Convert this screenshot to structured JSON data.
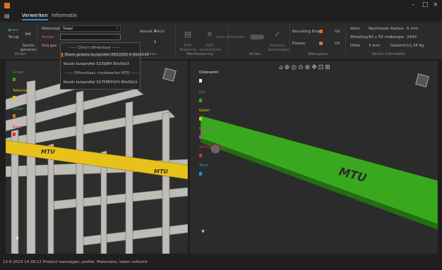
{
  "tabs": {
    "verwerken": "Verwerken",
    "informatie": "Informatie"
  },
  "ribbon": {
    "terug": "Terug",
    "sectie": "Sectie\ngeneren",
    "acties_group": "Acties",
    "materiaal_label": "Materiaal",
    "materiaal_value": "Staal",
    "artikel_label": "Artikel",
    "snij_label": "Snij gas",
    "aantal_label": "Aantal set(s)",
    "aantal_value": "1",
    "aantal2_value": "1",
    "cores_group": "Cores",
    "pdf_tekening": "PDF\nTekening",
    "pdf_verwijderen": "PDF\nverwijderen",
    "werktekening_group": "Werktekening",
    "auto_uitvoeren": "Auto uitvoeren",
    "product_bevestigen": "Product\nbevestigen",
    "acties2_group": "Acties",
    "bounding_box": "Bounding Box",
    "bounding_box_value": "Uit",
    "planes": "Planes",
    "planes_value": "Uit",
    "weergave_group": "Weergave",
    "info_vorm_l": "Vorm",
    "info_vorm_v": "Rechthoek",
    "info_radius_l": "Radius",
    "info_radius_v": "6 mm",
    "info_afm_l": "Afmeting",
    "info_afm_v": "80 x 50 mm",
    "info_lengte_l": "Lengte",
    "info_lengte_v": "2400",
    "info_dikte_l": "Dikte",
    "info_dikte_v": "3 mm",
    "info_gewicht_l": "Gewicht",
    "info_gewicht_v": "12,34 Kg",
    "info_group": "Sectie informatie"
  },
  "dropdown": {
    "opt1": "------ Direct offreerbaar ------",
    "opt2": "Blank gelaste buisprofiel EN10305-5 80x50x3",
    "opt3": "Koudv buisprofiel S235JRH 80x50x3",
    "opt4": "------ Offreerbaar, medewerker MTU ------",
    "opt5": "Koudv buisprofiel S275MDH(H) 80x50x3"
  },
  "left_labels": {
    "l1": "Groen",
    "l2": "Tekening",
    "l3": "Groen",
    "l4": "Rood"
  },
  "right_labels": {
    "r1": "Onbewerkt",
    "r2": "Gat",
    "r3": "Gaten",
    "r4": "Kruisgat",
    "r5": "Stiftmarkering",
    "r6": "Tekst"
  },
  "brand": "MTU",
  "status": "12-6-2023 14:38:12 Product toevoegen: profiel. Materiales, laden voltooid.",
  "colors": {
    "accent": "#e07020",
    "green": "#3aa81e",
    "yellow": "#e8c21a",
    "blue": "#2f8fd5"
  }
}
